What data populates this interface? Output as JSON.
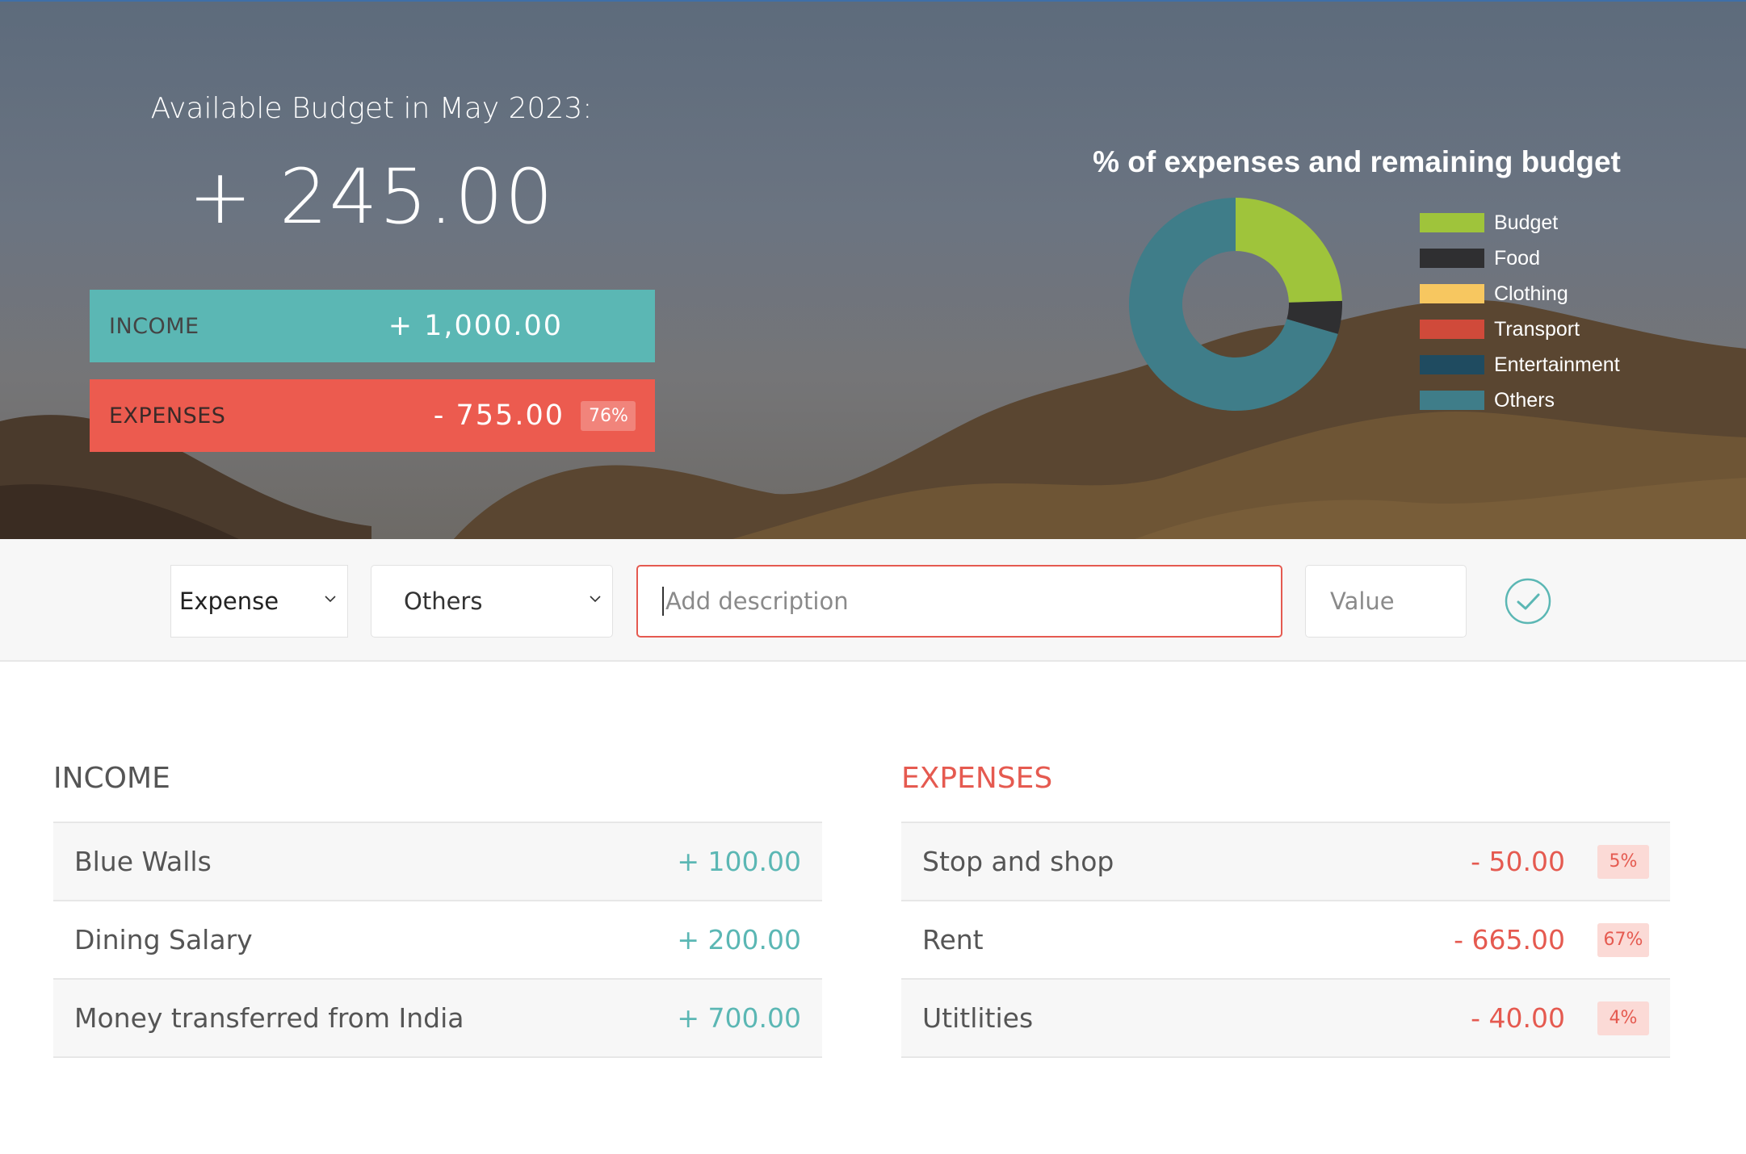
{
  "header": {
    "budget_title": "Available Budget in May 2023:",
    "budget_value": "+ 245.00",
    "income_label": "INCOME",
    "income_value": "+ 1,000.00",
    "expenses_label": "EXPENSES",
    "expenses_value": "- 755.00",
    "expenses_percentage": "76%"
  },
  "chart_data": {
    "type": "pie",
    "title": "% of expenses and remaining budget",
    "legend_placement": "right",
    "categories": [
      "Budget",
      "Food",
      "Clothing",
      "Transport",
      "Entertainment",
      "Others"
    ],
    "values": [
      24.5,
      5,
      0,
      0,
      0,
      70.5
    ],
    "colors": [
      "#9fc43b",
      "#2f2f31",
      "#f7c760",
      "#d04a3a",
      "#1f4b60",
      "#3f7d89"
    ]
  },
  "add_form": {
    "type_value": "Expense",
    "category_value": "Others",
    "description_placeholder": "Add description",
    "value_placeholder": "Value",
    "submit_icon": "checkmark-icon"
  },
  "income": {
    "title": "INCOME",
    "items": [
      {
        "description": "Blue Walls",
        "value": "+ 100.00"
      },
      {
        "description": "Dining Salary",
        "value": "+ 200.00"
      },
      {
        "description": "Money transferred from India",
        "value": "+ 700.00"
      }
    ]
  },
  "expenses": {
    "title": "EXPENSES",
    "items": [
      {
        "description": "Stop and shop",
        "value": "- 50.00",
        "percentage": "5%"
      },
      {
        "description": "Rent",
        "value": "- 665.00",
        "percentage": "67%"
      },
      {
        "description": "Utitlities",
        "value": "- 40.00",
        "percentage": "4%"
      }
    ]
  },
  "colors": {
    "income_accent": "#5bb7b4",
    "expenses_accent": "#ec5b4f"
  }
}
